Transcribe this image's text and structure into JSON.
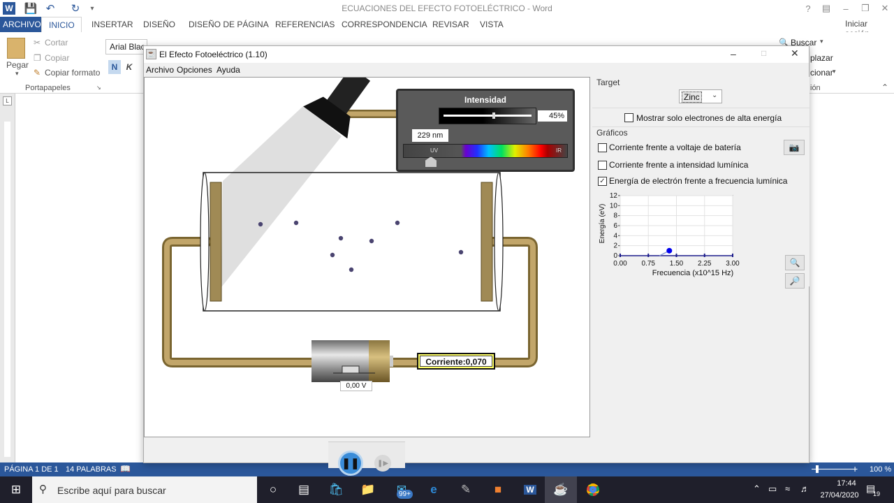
{
  "word": {
    "title": "ECUACIONES DEL EFECTO FOTOELÉCTRICO - Word",
    "signin": "Iniciar sesión",
    "tabs": [
      "ARCHIVO",
      "INICIO",
      "INSERTAR",
      "DISEÑO",
      "DISEÑO DE PÁGINA",
      "REFERENCIAS",
      "CORRESPONDENCIA",
      "REVISAR",
      "VISTA"
    ],
    "clipboard": {
      "paste": "Pegar",
      "cut": "Cortar",
      "copy": "Copiar",
      "format_painter": "Copiar formato",
      "group": "Portapapeles"
    },
    "font_name": "Arial Blac",
    "bold": "N",
    "italic": "K",
    "find": "Buscar",
    "replace": "plazar",
    "select": "cionar",
    "editing_group": "ión",
    "status": {
      "page": "PÁGINA 1 DE 1",
      "words": "14 PALABRAS",
      "zoom": "100 %"
    }
  },
  "app": {
    "title": "El Efecto Fotoeléctrico (1.10)",
    "menu": [
      "Archivo",
      "Opciones",
      "Ayuda"
    ],
    "intensity": {
      "title": "Intensidad",
      "value": "45%",
      "level": 0.45
    },
    "wavelength": {
      "value": "229 nm",
      "uv_label": "UV",
      "ir_label": "IR"
    },
    "battery_voltage": "0,00 V",
    "current_label": "Corriente:0,070",
    "target": {
      "label": "Target",
      "selected": "Zinc"
    },
    "high_energy_only": "Mostrar solo electrones de alta energía",
    "graphs": {
      "label": "Gráficos",
      "options": [
        {
          "text": "Corriente frente a voltaje de batería",
          "checked": false
        },
        {
          "text": "Corriente frente a intensidad lumínica",
          "checked": false
        },
        {
          "text": "Energía de electrón frente a frecuencia lumínica",
          "checked": true
        }
      ]
    }
  },
  "taskbar": {
    "search": "Escribe aquí para buscar",
    "time": "17:44",
    "date": "27/04/2020",
    "badge": "99+",
    "notif": "19"
  },
  "chart_data": {
    "type": "line",
    "title": "",
    "xlabel": "Frecuencia (x10^15 Hz)",
    "ylabel": "Energía (eV)",
    "xlim": [
      0,
      3
    ],
    "ylim": [
      0,
      12
    ],
    "xticks": [
      "0.00",
      "0.75",
      "1.50",
      "2.25",
      "3.00"
    ],
    "yticks": [
      "0",
      "2",
      "4",
      "6",
      "8",
      "10",
      "12"
    ],
    "series": [
      {
        "x": [
          1.05,
          1.31
        ],
        "y": [
          0.0,
          1.0
        ]
      }
    ],
    "grid": true
  }
}
